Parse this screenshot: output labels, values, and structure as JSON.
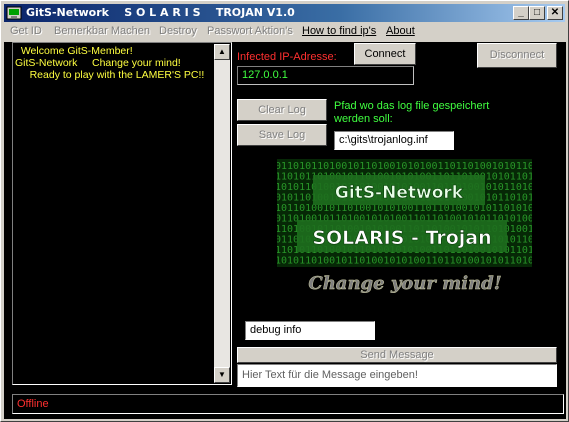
{
  "window": {
    "title": "GitS-Network    S O L A R I S    TROJAN V1.0",
    "controls": {
      "minimize": "_",
      "maximize": "□",
      "close": "✕"
    }
  },
  "menu": [
    {
      "label": "Get ID",
      "enabled": false
    },
    {
      "label": "Bemerkbar Machen",
      "enabled": false
    },
    {
      "label": "Destroy",
      "enabled": false
    },
    {
      "label": "Passwort Aktion's",
      "enabled": false
    },
    {
      "label": "How to find ip's",
      "enabled": true
    },
    {
      "label": "About",
      "enabled": true
    }
  ],
  "log": {
    "lines": [
      "  Welcome GitS-Member!",
      "GitS-Network     Change your mind!",
      "     Ready to play with the LAMER'S PC!!"
    ]
  },
  "connection": {
    "ip_label": "Infected IP-Adresse:",
    "ip_value": "127.0.0.1",
    "connect_label": "Connect",
    "disconnect_label": "Disconnect"
  },
  "logfile": {
    "clear_label": "Clear Log",
    "save_label": "Save Log",
    "path_label_line1": "Pfad wo das log file gespeichert",
    "path_label_line2": "werden soll:",
    "path_value": "c:\\gits\\trojanlog.inf"
  },
  "logo": {
    "line1": "GitS-Network",
    "line2": "SOLARIS - Trojan",
    "line3": "Change your mind!",
    "bg_glyphs": "0110101101001011010010101001101101001010110101001011010"
  },
  "messaging": {
    "debug_value": "debug info",
    "send_label": "Send Message",
    "message_value": "Hier Text für die Message eingeben!"
  },
  "status": {
    "text": "Offline"
  },
  "colors": {
    "log_text": "#ffff40",
    "accent_red": "#ff3030",
    "accent_green": "#40ff40",
    "client_bg": "#000000"
  }
}
